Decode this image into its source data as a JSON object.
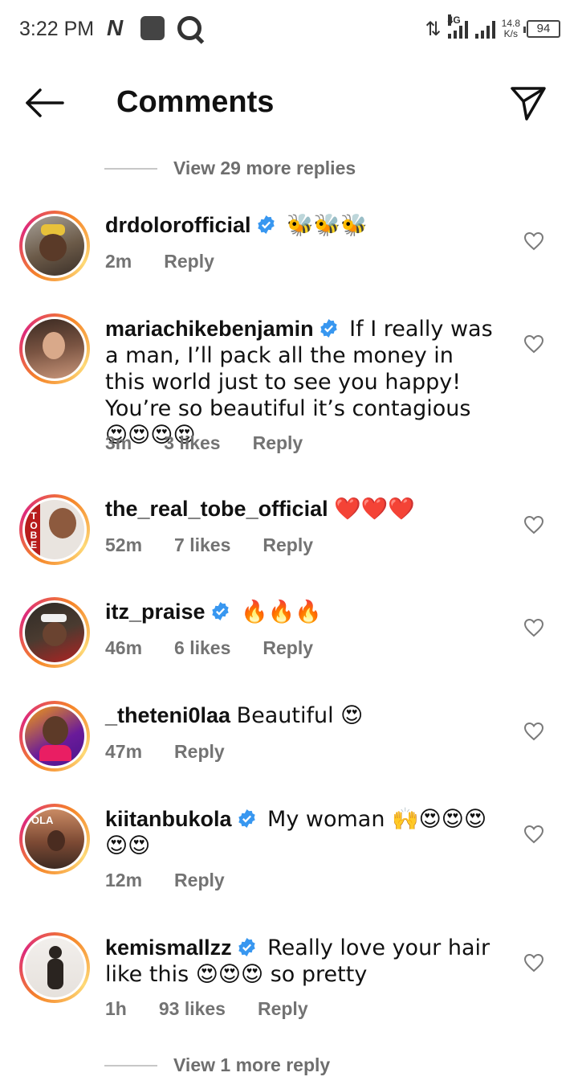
{
  "status_bar": {
    "time": "3:22 PM",
    "network": "4G",
    "speed_top": "14.8",
    "speed_bottom": "K/s",
    "battery": "94"
  },
  "header": {
    "title": "Comments",
    "back_icon": "arrow-left-icon",
    "share_icon": "send-icon"
  },
  "view_more_top": "View 29 more replies",
  "view_more_bottom": "View 1 more reply",
  "colors": {
    "ring_start": "#f58529",
    "ring_mid": "#dd2a7b",
    "verified": "#3897f0",
    "meta_text": "#737373"
  },
  "comments": [
    {
      "username": "drdolorofficial",
      "verified": true,
      "text": "🐝🐝🐝",
      "time": "2m",
      "likes": "",
      "reply": "Reply"
    },
    {
      "username": "mariachikebenjamin",
      "verified": true,
      "text": "If I really was a man, I’ll pack all the money in this world just to see you happy! You’re so beautiful it’s contagious 😍😍😍😍",
      "time": "3m",
      "likes": "3 likes",
      "reply": "Reply"
    },
    {
      "username": "the_real_tobe_official",
      "verified": false,
      "text": "❤️❤️❤️",
      "time": "52m",
      "likes": "7 likes",
      "reply": "Reply"
    },
    {
      "username": "itz_praise",
      "verified": true,
      "text": "🔥🔥🔥",
      "time": "46m",
      "likes": "6 likes",
      "reply": "Reply"
    },
    {
      "username": "_theteni0laa",
      "verified": false,
      "text": "Beautiful 😍",
      "time": "47m",
      "likes": "",
      "reply": "Reply"
    },
    {
      "username": "kiitanbukola",
      "verified": true,
      "text": "My woman 🙌😍😍😍😍😍",
      "time": "12m",
      "likes": "",
      "reply": "Reply"
    },
    {
      "username": "kemismallzz",
      "verified": true,
      "text": "Really love your hair like this 😍😍😍 so pretty",
      "time": "1h",
      "likes": "93 likes",
      "reply": "Reply"
    }
  ]
}
